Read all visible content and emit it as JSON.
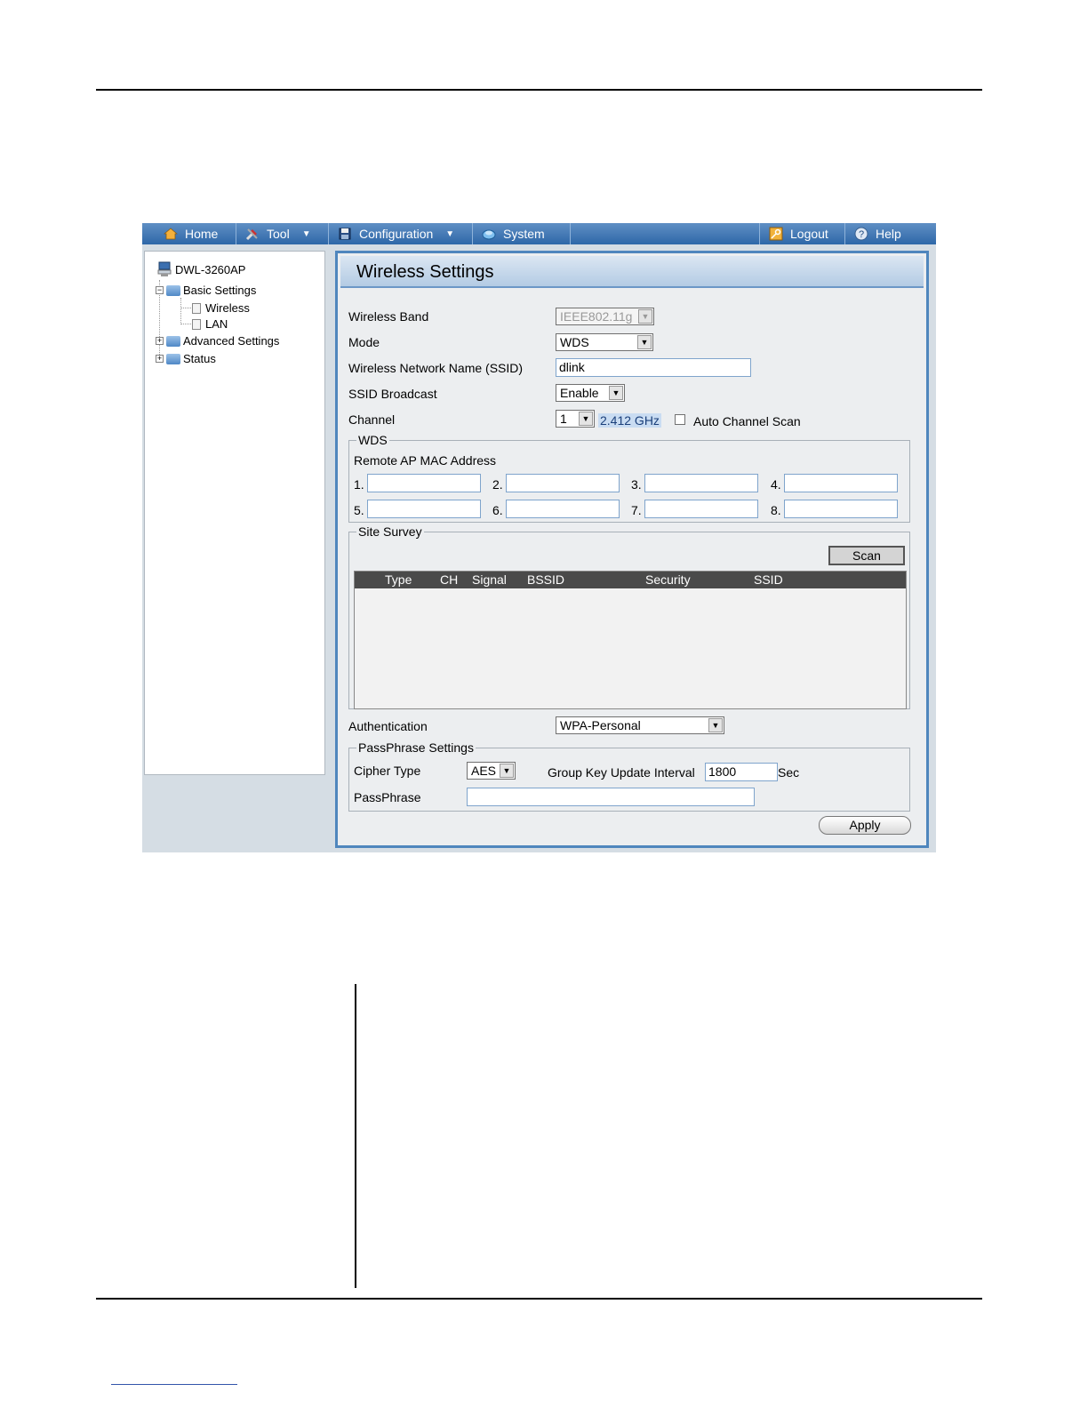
{
  "menu": {
    "home": "Home",
    "tool": "Tool",
    "configuration": "Configuration",
    "system": "System",
    "logout": "Logout",
    "help": "Help"
  },
  "tree": {
    "device": "DWL-3260AP",
    "basic_settings": "Basic Settings",
    "wireless": "Wireless",
    "lan": "LAN",
    "advanced_settings": "Advanced Settings",
    "status": "Status"
  },
  "panel": {
    "title": "Wireless Settings",
    "wireless_band": {
      "label": "Wireless Band",
      "value": "IEEE802.11g"
    },
    "mode": {
      "label": "Mode",
      "value": "WDS"
    },
    "ssid": {
      "label": "Wireless Network Name (SSID)",
      "value": "dlink"
    },
    "ssid_broadcast": {
      "label": "SSID Broadcast",
      "value": "Enable"
    },
    "channel": {
      "label": "Channel",
      "value": "1",
      "frequency": "2.412 GHz",
      "auto_scan_label": "Auto Channel Scan",
      "auto_scan_checked": false
    },
    "wds": {
      "legend": "WDS",
      "remote_label": "Remote AP MAC Address",
      "slots": [
        "1.",
        "2.",
        "3.",
        "4.",
        "5.",
        "6.",
        "7.",
        "8."
      ]
    },
    "site_survey": {
      "legend": "Site Survey",
      "scan_label": "Scan",
      "columns": [
        "Type",
        "CH",
        "Signal",
        "BSSID",
        "Security",
        "SSID"
      ]
    },
    "authentication": {
      "label": "Authentication",
      "value": "WPA-Personal"
    },
    "passphrase_settings": {
      "legend": "PassPhrase Settings",
      "cipher_label": "Cipher Type",
      "cipher_value": "AES",
      "group_key_label": "Group Key Update Interval",
      "group_key_value": "1800",
      "group_key_unit": "Sec",
      "passphrase_label": "PassPhrase",
      "passphrase_value": ""
    },
    "apply_label": "Apply"
  }
}
